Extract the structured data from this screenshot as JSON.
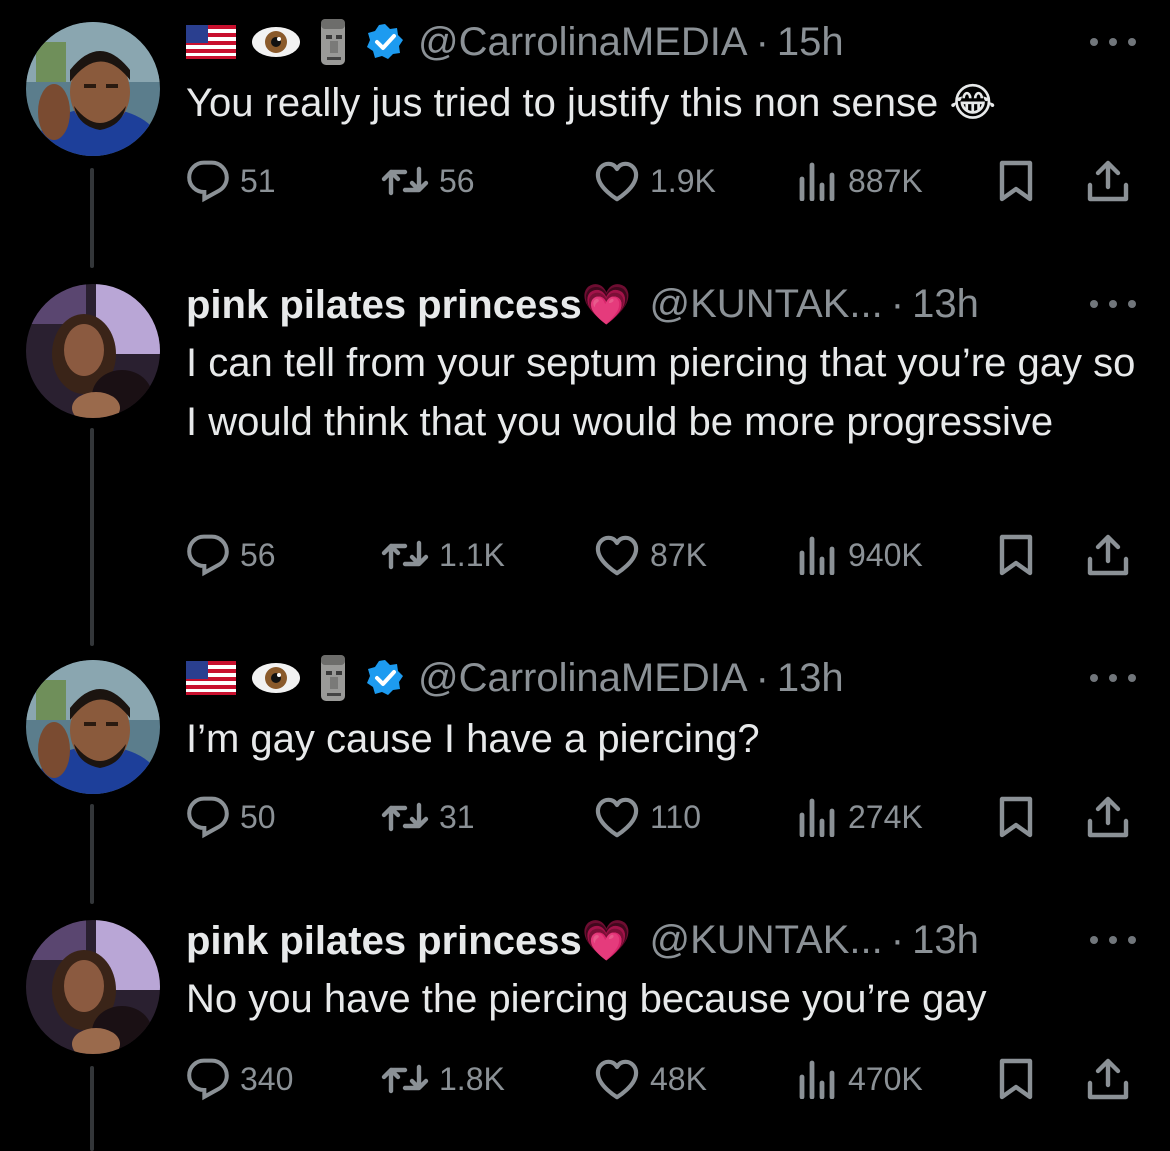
{
  "tweets": [
    {
      "name": "",
      "flag_emojis": true,
      "verified": true,
      "handle": "@CarrolinaMEDIA",
      "dot": "·",
      "time": "15h",
      "text": "You really jus tried to justify this non sense 😂",
      "replies": "51",
      "reposts": "56",
      "likes": "1.9K",
      "views": "887K",
      "avatar": "man-avatar"
    },
    {
      "name": "pink pilates princess💗",
      "flag_emojis": false,
      "verified": false,
      "handle": "@KUNTAK...",
      "dot": "·",
      "time": "13h",
      "text": "I can tell from your septum piercing that you’re gay so I would think that you would be more progressive",
      "replies": "56",
      "reposts": "1.1K",
      "likes": "87K",
      "views": "940K",
      "avatar": "woman-avatar"
    },
    {
      "name": "",
      "flag_emojis": true,
      "verified": true,
      "handle": "@CarrolinaMEDIA",
      "dot": "·",
      "time": "13h",
      "text": "I’m gay cause I have a piercing?",
      "replies": "50",
      "reposts": "31",
      "likes": "110",
      "views": "274K",
      "avatar": "man-avatar"
    },
    {
      "name": "pink pilates princess💗",
      "flag_emojis": false,
      "verified": false,
      "handle": "@KUNTAK...",
      "dot": "·",
      "time": "13h",
      "text": "No you have the piercing because you’re gay",
      "replies": "340",
      "reposts": "1.8K",
      "likes": "48K",
      "views": "470K",
      "avatar": "woman-avatar"
    }
  ],
  "colors": {
    "background": "#000000",
    "text": "#e7e9ea",
    "muted": "#8b9196",
    "verified": "#1d9bf0",
    "thread_line": "#333639"
  }
}
